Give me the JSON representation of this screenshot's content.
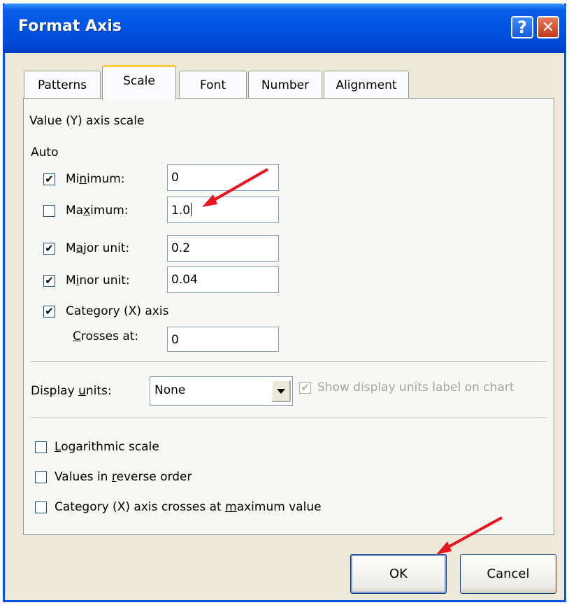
{
  "window": {
    "title": "Format Axis",
    "help_glyph": "?",
    "close_glyph": "✕"
  },
  "tabs": [
    {
      "label": "Patterns",
      "active": false
    },
    {
      "label": "Scale",
      "active": true
    },
    {
      "label": "Font",
      "active": false
    },
    {
      "label": "Number",
      "active": false
    },
    {
      "label": "Alignment",
      "active": false
    }
  ],
  "scale": {
    "section_title": "Value (Y) axis scale",
    "auto_label": "Auto",
    "minimum": {
      "label_pre": "Mi",
      "label_u": "n",
      "label_post": "imum:",
      "checked": true,
      "value": "0"
    },
    "maximum": {
      "label_pre": "Ma",
      "label_u": "x",
      "label_post": "imum:",
      "checked": false,
      "value": "1.0"
    },
    "major_unit": {
      "label_pre": "M",
      "label_u": "a",
      "label_post": "jor unit:",
      "checked": true,
      "value": "0.2"
    },
    "minor_unit": {
      "label_pre": "M",
      "label_u": "i",
      "label_post": "nor unit:",
      "checked": true,
      "value": "0.04"
    },
    "category_axis": {
      "label": "Category (X) axis",
      "checked": true
    },
    "crosses_at": {
      "label_u": "C",
      "label_post": "rosses at:",
      "value": "0"
    },
    "display_units": {
      "label_pre": "Display ",
      "label_u": "u",
      "label_post": "nits:",
      "value": "None"
    },
    "show_units_label": {
      "label": "Show display units label on chart",
      "checked": true,
      "enabled": false
    },
    "logarithmic": {
      "label_u": "L",
      "label_post": "ogarithmic scale",
      "checked": false
    },
    "reverse_order": {
      "label_pre": "Values in ",
      "label_u": "r",
      "label_post": "everse order",
      "checked": false
    },
    "crosses_at_max": {
      "label_pre": "Category (X) axis crosses at ",
      "label_u": "m",
      "label_post": "aximum value",
      "checked": false
    }
  },
  "buttons": {
    "ok": "OK",
    "cancel": "Cancel"
  },
  "icons": {
    "check": "✔",
    "dropdown": "dropdown-arrow-icon",
    "annotation_arrow": "red-arrow-icon"
  },
  "colors": {
    "titlebar": "#0055e5",
    "dialog_bg": "#ece9d8",
    "annotation": "#e8141e"
  }
}
